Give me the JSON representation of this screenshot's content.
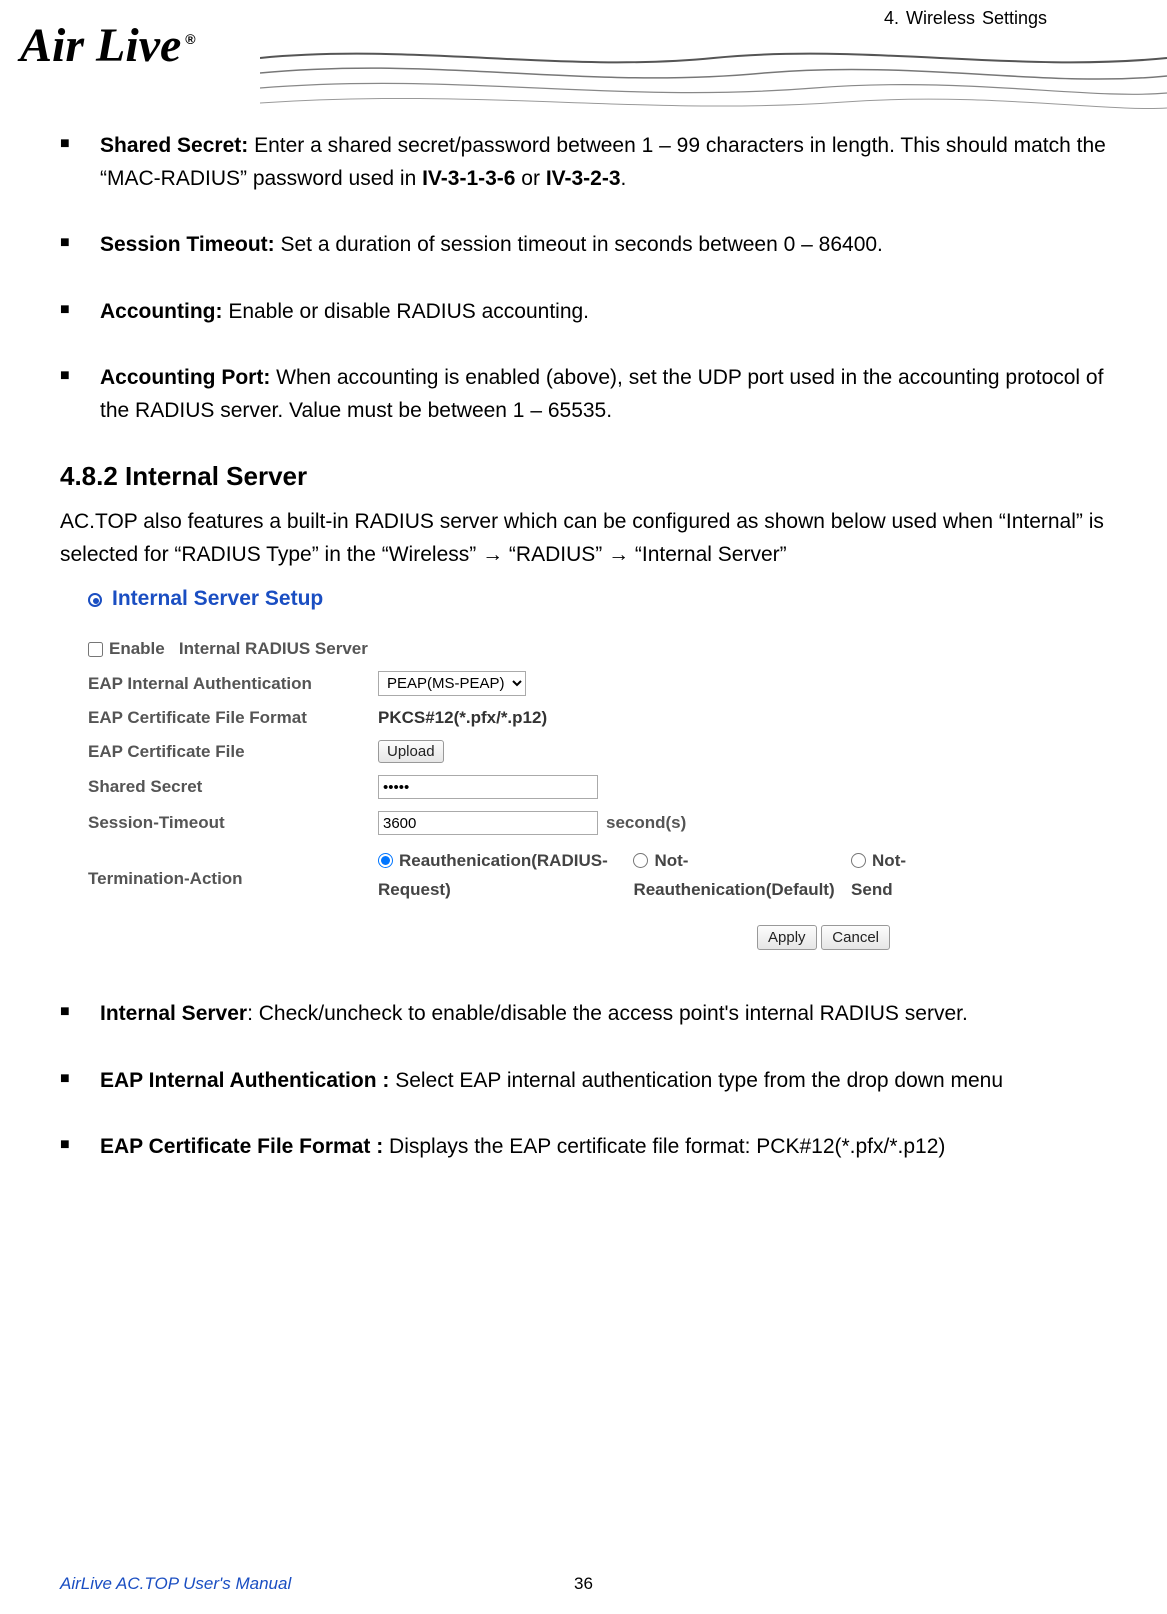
{
  "header": {
    "chapter": "4.  Wireless  Settings",
    "logo_text": "Air Live"
  },
  "bullets_top": [
    {
      "label": "Shared Secret:",
      "text_before_ref": " Enter a shared secret/password between 1 – 99 characters in length. This should match the “MAC-RADIUS” password used in ",
      "ref1": "IV-3-1-3-6",
      "mid": " or ",
      "ref2": "IV-3-2-3",
      "tail": "."
    },
    {
      "label": "Session Timeout:",
      "text": " Set a duration of session timeout in seconds between 0 – 86400."
    },
    {
      "label": "Accounting:",
      "text": " Enable or disable RADIUS accounting."
    },
    {
      "label": "Accounting Port:",
      "text": " When accounting is enabled (above), set the UDP port used in the accounting protocol of the RADIUS server. Value must be between 1 – 65535."
    }
  ],
  "section_heading": "4.8.2  Internal Server",
  "intro_text": "AC.TOP also features a built-in RADIUS server which can be configured as shown below used when “Internal” is selected for “RADIUS Type” in the “Wireless” → “RADIUS” → “Internal Server”",
  "screenshot": {
    "title": "Internal Server Setup",
    "enable_label_before": "Enable",
    "enable_label_after": "   Internal RADIUS Server",
    "rows": {
      "eap_auth_label": "EAP Internal Authentication",
      "eap_auth_value": "PEAP(MS-PEAP)",
      "eap_fmt_label": "EAP Certificate File Format",
      "eap_fmt_value": "PKCS#12(*.pfx/*.p12)",
      "eap_file_label": "EAP Certificate File",
      "upload_btn": "Upload",
      "secret_label": "Shared Secret",
      "secret_value": "•••••",
      "timeout_label": "Session-Timeout",
      "timeout_value": "3600",
      "timeout_unit": "second(s)",
      "term_label": "Termination-Action",
      "radio1": "Reauthenication(RADIUS-Request)",
      "radio2": "Not-Reauthenication(Default)",
      "radio3": "Not-Send"
    },
    "apply_btn": "Apply",
    "cancel_btn": "Cancel"
  },
  "bullets_bottom": [
    {
      "label": "Internal Server",
      "text": ": Check/uncheck to enable/disable the access point's internal RADIUS server."
    },
    {
      "label": "EAP Internal Authentication :",
      "text": " Select EAP internal authentication type from the drop down menu"
    },
    {
      "label": "EAP Certificate File Format :",
      "text": " Displays the EAP certificate file format: PCK#12(*.pfx/*.p12)"
    }
  ],
  "footer": {
    "manual": "AirLive AC.TOP User's Manual",
    "page": "36"
  }
}
